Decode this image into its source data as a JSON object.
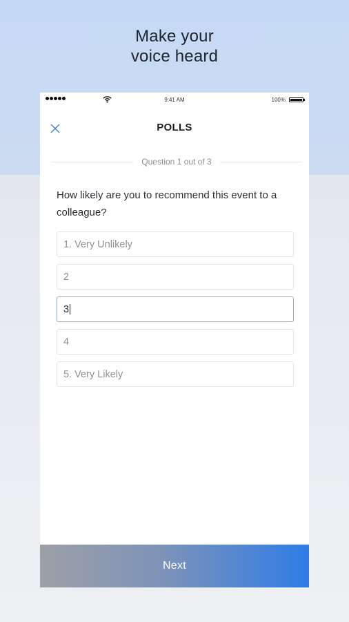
{
  "headline": {
    "line1": "Make your",
    "line2": "voice heard"
  },
  "status_bar": {
    "time": "9:41 AM",
    "battery": "100%"
  },
  "nav": {
    "title": "POLLS",
    "close_icon": "close-icon"
  },
  "progress": {
    "label": "Question 1 out of 3"
  },
  "question": {
    "text": "How likely are you to recommend this event to a colleague?"
  },
  "options": [
    {
      "label": "1. Very Unlikely",
      "selected": false
    },
    {
      "label": "2",
      "selected": false
    },
    {
      "label": "3",
      "selected": true
    },
    {
      "label": "4",
      "selected": false
    },
    {
      "label": "5. Very Likely",
      "selected": false
    }
  ],
  "footer": {
    "next_label": "Next"
  },
  "colors": {
    "accent": "#2f7ce8",
    "selected_border": "#8ea8d8",
    "top_background": "#c6d9f4"
  }
}
